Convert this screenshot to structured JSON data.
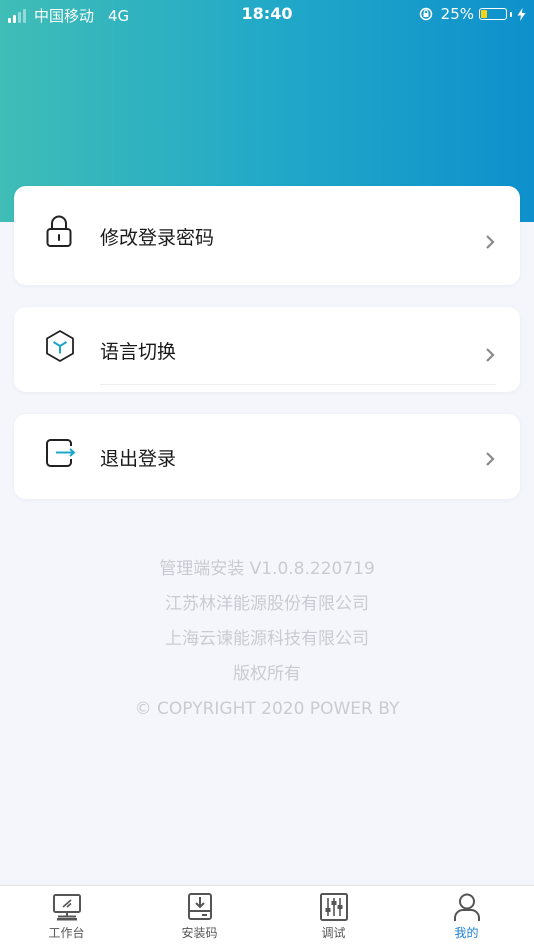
{
  "status_bar": {
    "carrier": "中国移动",
    "network": "4G",
    "time": "18:40",
    "battery": "25%",
    "battery_level": 0.25,
    "battery_color": "#f5d313"
  },
  "theme": {
    "gradient_start": "#3fbdb6",
    "gradient_end": "#0e90cc",
    "accent": "#1a7fd3"
  },
  "menu": {
    "change_password": {
      "label": "修改登录密码",
      "icon": "lock-icon"
    },
    "language": {
      "label": "语言切换",
      "icon": "cube-icon"
    },
    "logout": {
      "label": "退出登录",
      "icon": "logout-icon"
    }
  },
  "footer": {
    "version": "管理端安装 V1.0.8.220719",
    "company1": "江苏林洋能源股份有限公司",
    "company2": "上海云谏能源科技有限公司",
    "rights": "版权所有",
    "copyright": "© COPYRIGHT 2020 POWER BY"
  },
  "tabbar": {
    "tabs": [
      {
        "label": "工作台",
        "icon": "monitor-icon"
      },
      {
        "label": "安装码",
        "icon": "download-box-icon"
      },
      {
        "label": "调试",
        "icon": "sliders-icon"
      },
      {
        "label": "我的",
        "icon": "user-icon"
      }
    ],
    "active_index": 3
  }
}
